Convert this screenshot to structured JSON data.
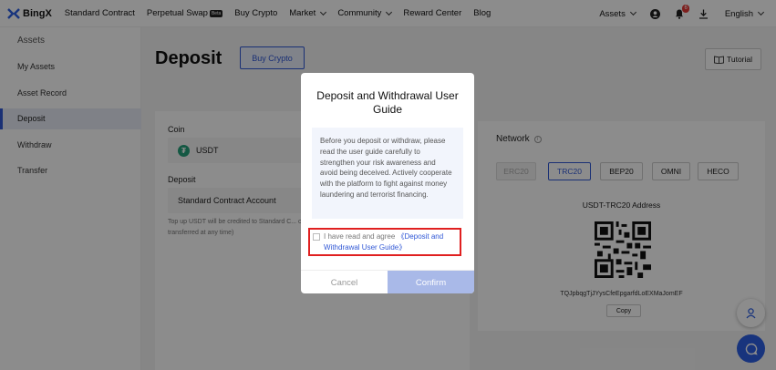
{
  "nav": {
    "logo": "BingX",
    "links": [
      "Standard Contract",
      "Perpetual Swap",
      "Buy Crypto",
      "Market",
      "Community",
      "Reward Center",
      "Blog"
    ],
    "beta": "Beta",
    "assets": "Assets",
    "notification_count": "6",
    "language": "English"
  },
  "sidebar": {
    "title": "Assets",
    "items": [
      "My Assets",
      "Asset Record",
      "Deposit",
      "Withdraw",
      "Transfer"
    ],
    "active": "Deposit"
  },
  "main": {
    "title": "Deposit",
    "buy_crypto": "Buy Crypto",
    "tutorial": "Tutorial",
    "coin_label": "Coin",
    "coin": "USDT",
    "deposit_label": "Deposit",
    "account": "Standard Contract Account",
    "hint": "Top up USDT will be credited to Standard C... can be transferred at any time)"
  },
  "network": {
    "title": "Network",
    "options": [
      "ERC20",
      "TRC20",
      "BEP20",
      "OMNI",
      "HECO"
    ],
    "selected": "TRC20",
    "disabled": "ERC20",
    "address_title": "USDT-TRC20 Address",
    "address": "TQJpbqgTjJYysCfeEpgarfdLoEXMaJomEF",
    "copy": "Copy"
  },
  "modal": {
    "title": "Deposit and Withdrawal User Guide",
    "notice": "Before you deposit or withdraw, please read the user guide carefully to strengthen your risk awareness and avoid being deceived. Actively cooperate with the platform to fight against money laundering and terrorist financing.",
    "agree_prefix": "I have read and agree",
    "agree_link": "《Deposit and Withdrawal User Guide》",
    "cancel": "Cancel",
    "confirm": "Confirm"
  },
  "colors": {
    "accent": "#3158d6",
    "highlight": "#e02020",
    "confirm_disabled": "#a9b9e8",
    "tether": "#26a17b",
    "chat": "#2c5fe3"
  }
}
